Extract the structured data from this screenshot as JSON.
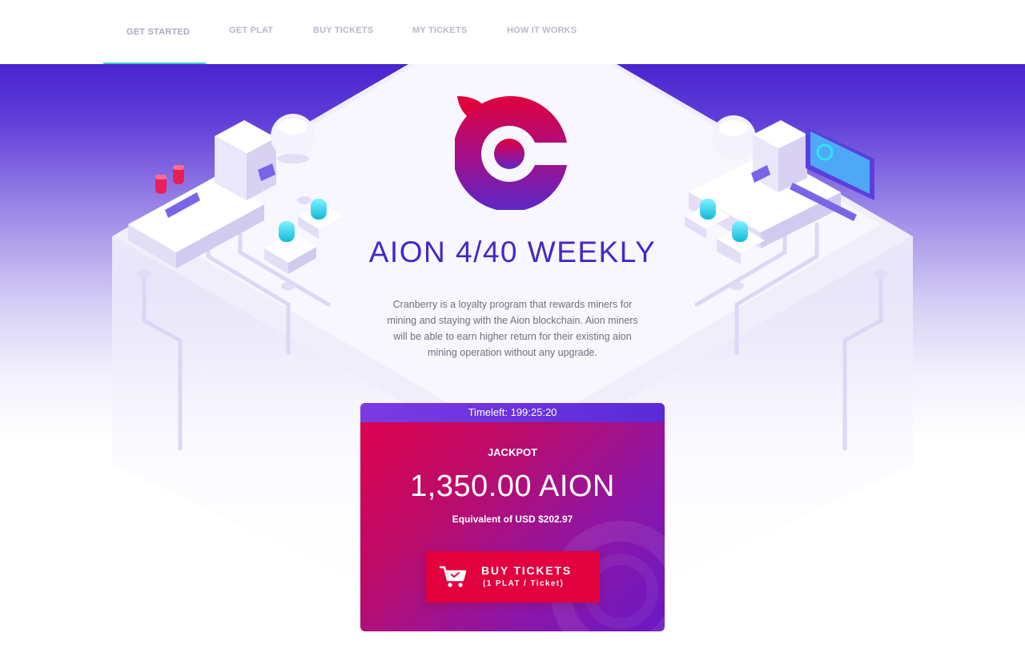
{
  "nav": {
    "items": [
      {
        "label": "GET STARTED",
        "active": true
      },
      {
        "label": "GET PLAT",
        "active": false
      },
      {
        "label": "BUY TICKETS",
        "active": false
      },
      {
        "label": "MY TICKETS",
        "active": false
      },
      {
        "label": "HOW IT WORKS",
        "active": false
      }
    ]
  },
  "hero": {
    "title": "AION 4/40 WEEKLY",
    "description": "Cranberry is a loyalty program that rewards miners for mining and staying with the Aion blockchain. Aion miners will be able to earn higher return for their existing aion mining operation without any upgrade."
  },
  "card": {
    "timer": "Timeleft: 199:25:20",
    "label": "JACKPOT",
    "amount": "1,350.00 AION",
    "equivalent": "Equivalent of USD $202.97",
    "button": {
      "label": "BUY TICKETS",
      "sublabel": "(1 PLAT / Ticket)",
      "icon": "shopping-cart-icon"
    }
  },
  "colors": {
    "brand_blue": "#4527c8",
    "brand_red": "#e2003e",
    "nav_active_underline": "#3ecfc0",
    "hero_top": "#4a24d0"
  }
}
